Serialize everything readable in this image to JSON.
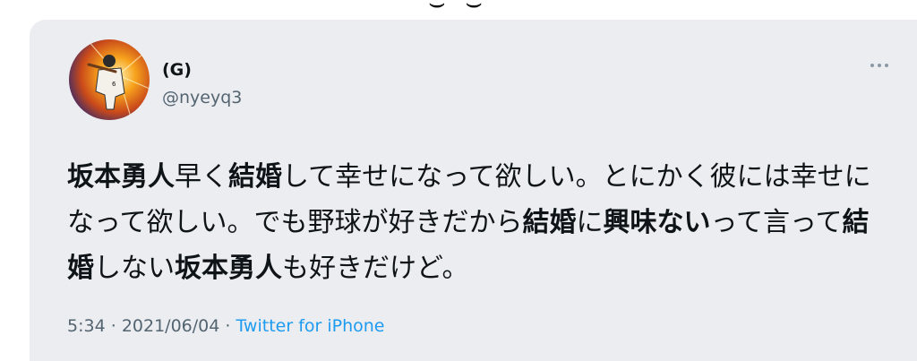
{
  "header": {
    "top_glyph": "ツイート"
  },
  "tweet": {
    "display_name": "(G)",
    "handle": "@nyeyq3",
    "text_segments": [
      {
        "text": "坂本勇人",
        "bold": true
      },
      {
        "text": "早く",
        "bold": false
      },
      {
        "text": "結婚",
        "bold": true
      },
      {
        "text": "して幸せになって欲しい。とにかく彼には幸せになって欲しい。でも野球が好きだから",
        "bold": false
      },
      {
        "text": "結婚",
        "bold": true
      },
      {
        "text": "に",
        "bold": false
      },
      {
        "text": "興味ない",
        "bold": true
      },
      {
        "text": "って言って",
        "bold": false
      },
      {
        "text": "結婚",
        "bold": true
      },
      {
        "text": "しない",
        "bold": false
      },
      {
        "text": "坂本勇人",
        "bold": true
      },
      {
        "text": "も好きだけど。",
        "bold": false
      }
    ],
    "time": "5:34",
    "separator": "·",
    "date": "2021/06/04",
    "source": "Twitter for iPhone"
  },
  "icons": {
    "avatar": "baseball-player-avatar",
    "more": "more-options-icon"
  },
  "colors": {
    "card_bg": "#ecedf0",
    "text_primary": "#0f1419",
    "text_secondary": "#536471",
    "link": "#1d9bf0"
  }
}
